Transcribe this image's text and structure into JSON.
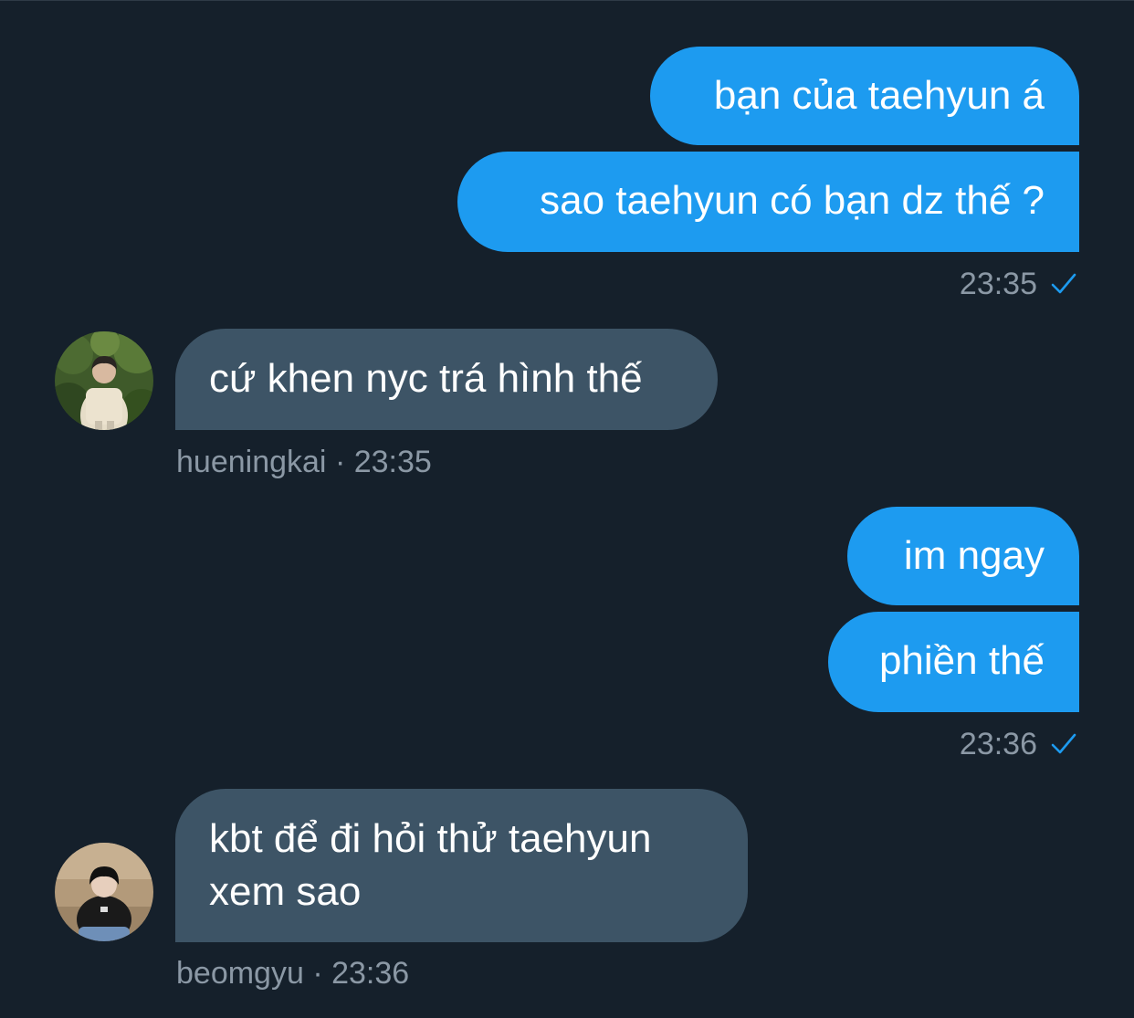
{
  "conversation": {
    "group1": {
      "messages": [
        "bạn của taehyun á",
        "sao taehyun có bạn dz thế ?"
      ],
      "time": "23:35"
    },
    "reply1": {
      "message": "cứ khen nyc trá hình thế",
      "author": "hueningkai",
      "separator": "·",
      "time": "23:35"
    },
    "group2": {
      "messages": [
        "im ngay",
        "phiền thế"
      ],
      "time": "23:36"
    },
    "reply2": {
      "message": "kbt để đi hỏi thử taehyun xem sao",
      "author": "beomgyu",
      "separator": "·",
      "time": "23:36"
    }
  },
  "icons": {
    "read_receipt": "checkmark-icon",
    "avatar": "avatar"
  },
  "colors": {
    "background": "#15202b",
    "sent_bubble": "#1d9bf0",
    "received_bubble": "#3d5466",
    "meta_text": "#8b98a5",
    "check": "#1d9bf0"
  }
}
